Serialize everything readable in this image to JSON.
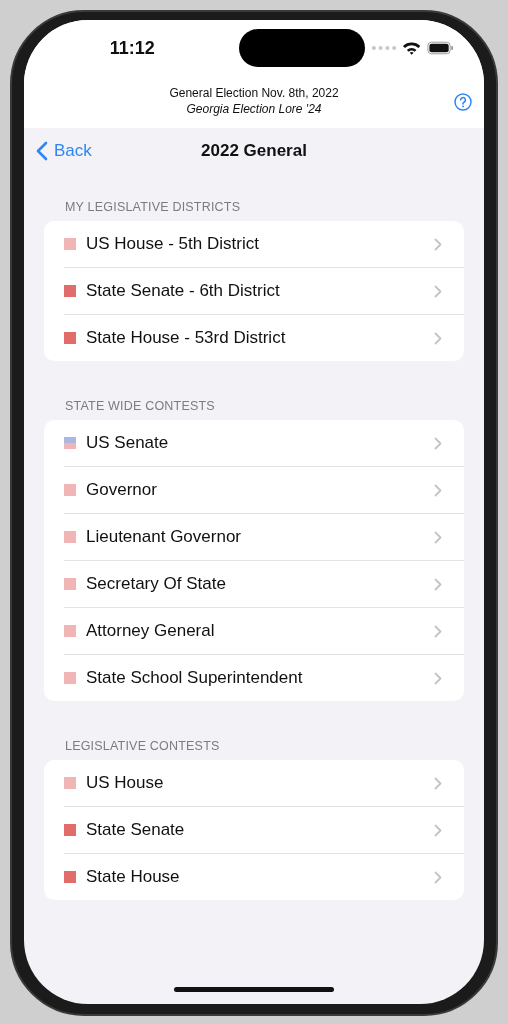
{
  "status_bar": {
    "time": "11:12"
  },
  "header": {
    "title": "General Election Nov. 8th, 2022",
    "subtitle": "Georgia Election Lore '24"
  },
  "nav": {
    "back": "Back",
    "title": "2022 General"
  },
  "sections": [
    {
      "header": "MY LEGISLATIVE DISTRICTS",
      "items": [
        {
          "label": "US House - 5th District",
          "kind": "solid",
          "color": "#f2b5b5"
        },
        {
          "label": "State Senate - 6th District",
          "kind": "solid",
          "color": "#e06c6c"
        },
        {
          "label": "State House - 53rd District",
          "kind": "solid",
          "color": "#e06c6c"
        }
      ]
    },
    {
      "header": "STATE WIDE CONTESTS",
      "items": [
        {
          "label": "US Senate",
          "kind": "split",
          "stripes": [
            {
              "color": "#a9b8e0"
            },
            {
              "color": "#f2b5b5"
            }
          ]
        },
        {
          "label": "Governor",
          "kind": "solid",
          "color": "#f2b5b5"
        },
        {
          "label": "Lieutenant Governor",
          "kind": "solid",
          "color": "#f2b5b5"
        },
        {
          "label": "Secretary Of State",
          "kind": "solid",
          "color": "#f2b5b5"
        },
        {
          "label": "Attorney General",
          "kind": "solid",
          "color": "#f2b5b5"
        },
        {
          "label": "State School Superintendent",
          "kind": "solid",
          "color": "#f2b5b5"
        }
      ]
    },
    {
      "header": "LEGISLATIVE CONTESTS",
      "items": [
        {
          "label": "US House",
          "kind": "solid",
          "color": "#f2b5b5"
        },
        {
          "label": "State Senate",
          "kind": "solid",
          "color": "#e06c6c"
        },
        {
          "label": "State House",
          "kind": "solid",
          "color": "#e06c6c"
        }
      ]
    }
  ]
}
